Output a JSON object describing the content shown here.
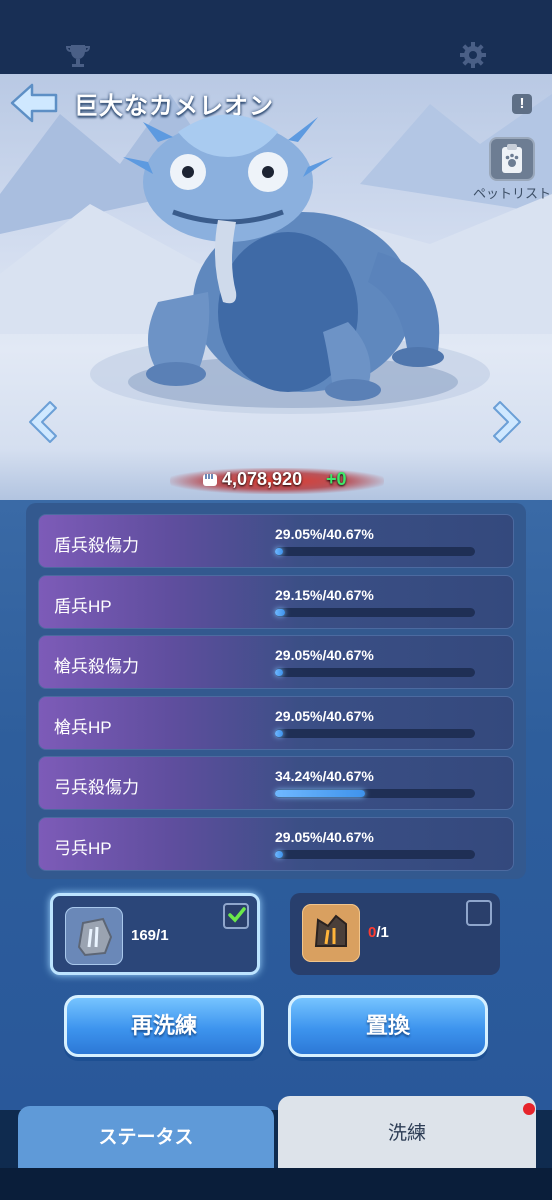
{
  "header": {
    "title": "巨大なカメレオン",
    "petlist_label": "ペットリスト"
  },
  "power": {
    "value": "4,078,920",
    "delta": "+0"
  },
  "stats": [
    {
      "name": "盾兵殺傷力",
      "value": "29.05%/40.67%",
      "fill": 0.04
    },
    {
      "name": "盾兵HP",
      "value": "29.15%/40.67%",
      "fill": 0.05
    },
    {
      "name": "槍兵殺傷力",
      "value": "29.05%/40.67%",
      "fill": 0.04
    },
    {
      "name": "槍兵HP",
      "value": "29.05%/40.67%",
      "fill": 0.04
    },
    {
      "name": "弓兵殺傷力",
      "value": "34.24%/40.67%",
      "fill": 0.45
    },
    {
      "name": "弓兵HP",
      "value": "29.05%/40.67%",
      "fill": 0.04
    }
  ],
  "items": [
    {
      "count": "169/1",
      "selected": true
    },
    {
      "count_have": "0",
      "count_need": "/1",
      "selected": false
    }
  ],
  "buttons": {
    "reforge": "再洗練",
    "replace": "置換"
  },
  "tabs": {
    "status": "ステータス",
    "refine": "洗練"
  },
  "colors": {
    "accent_blue": "#3d94ee",
    "stat_fill": "#6fb8ff",
    "delta_green": "#3ee86a",
    "zero_red": "#ff3b30"
  }
}
